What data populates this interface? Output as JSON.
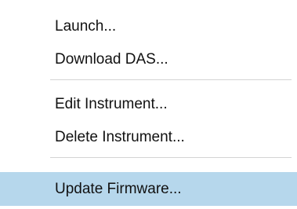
{
  "menu": {
    "items": [
      {
        "label": "Launch..."
      },
      {
        "label": "Download DAS..."
      },
      {
        "label": "Edit Instrument..."
      },
      {
        "label": "Delete Instrument..."
      },
      {
        "label": "Update Firmware..."
      }
    ],
    "highlight_color": "#b6d7ec"
  }
}
